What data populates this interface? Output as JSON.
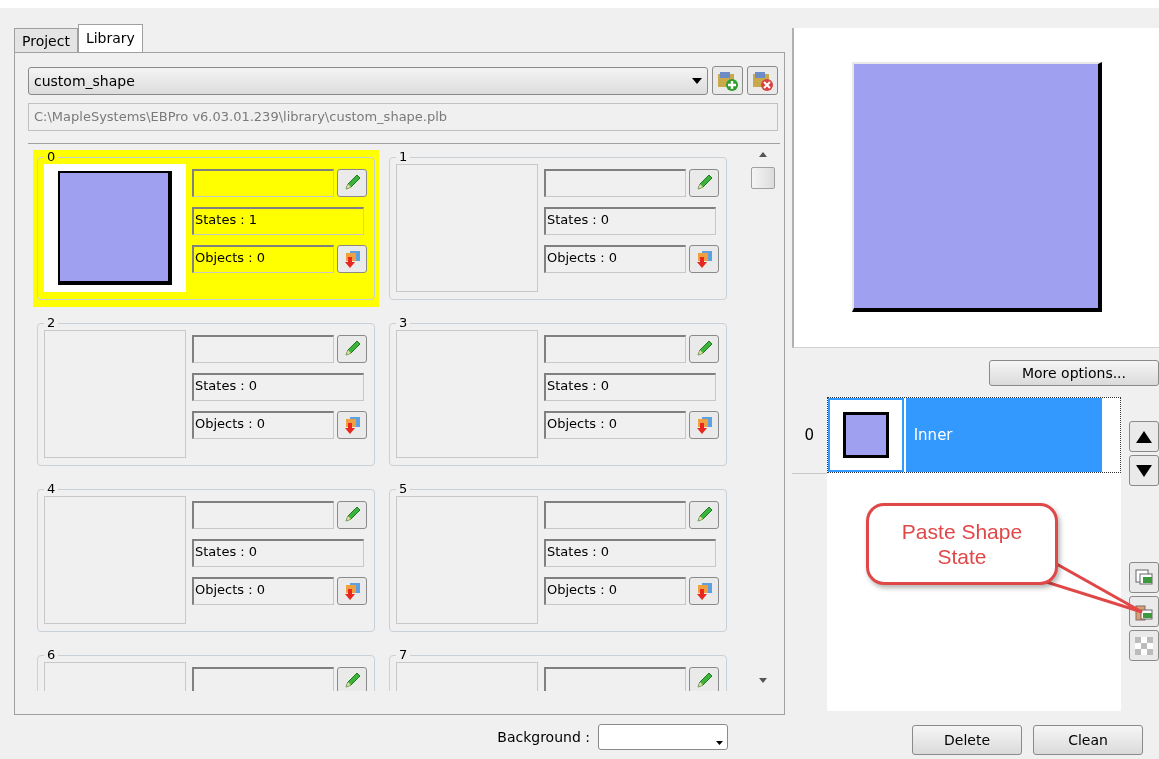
{
  "tabs": [
    {
      "label": "Project",
      "selected": false
    },
    {
      "label": "Library",
      "selected": true
    }
  ],
  "library": {
    "value": "custom_shape"
  },
  "path": {
    "value": "C:\\MapleSystems\\EBPro v6.03.01.239\\library\\custom_shape.plb"
  },
  "shapes": [
    {
      "number": "0",
      "selected": true,
      "thumbnail": true,
      "states": "States : 1",
      "objects": "Objects : 0"
    },
    {
      "number": "1",
      "selected": false,
      "thumbnail": false,
      "states": "States : 0",
      "objects": "Objects : 0"
    },
    {
      "number": "2",
      "selected": false,
      "thumbnail": false,
      "states": "States : 0",
      "objects": "Objects : 0"
    },
    {
      "number": "3",
      "selected": false,
      "thumbnail": false,
      "states": "States : 0",
      "objects": "Objects : 0"
    },
    {
      "number": "4",
      "selected": false,
      "thumbnail": false,
      "states": "States : 0",
      "objects": "Objects : 0"
    },
    {
      "number": "5",
      "selected": false,
      "thumbnail": false,
      "states": "States : 0",
      "objects": "Objects : 0"
    },
    {
      "number": "6",
      "selected": false,
      "thumbnail": false
    },
    {
      "number": "7",
      "selected": false,
      "thumbnail": false
    }
  ],
  "background": {
    "label": "Background :"
  },
  "more_options": "More options...",
  "states": [
    {
      "index": "0",
      "name": "Inner",
      "selected": true
    }
  ],
  "callout": "Paste Shape State",
  "buttons": [
    "Delete",
    "Clean"
  ]
}
